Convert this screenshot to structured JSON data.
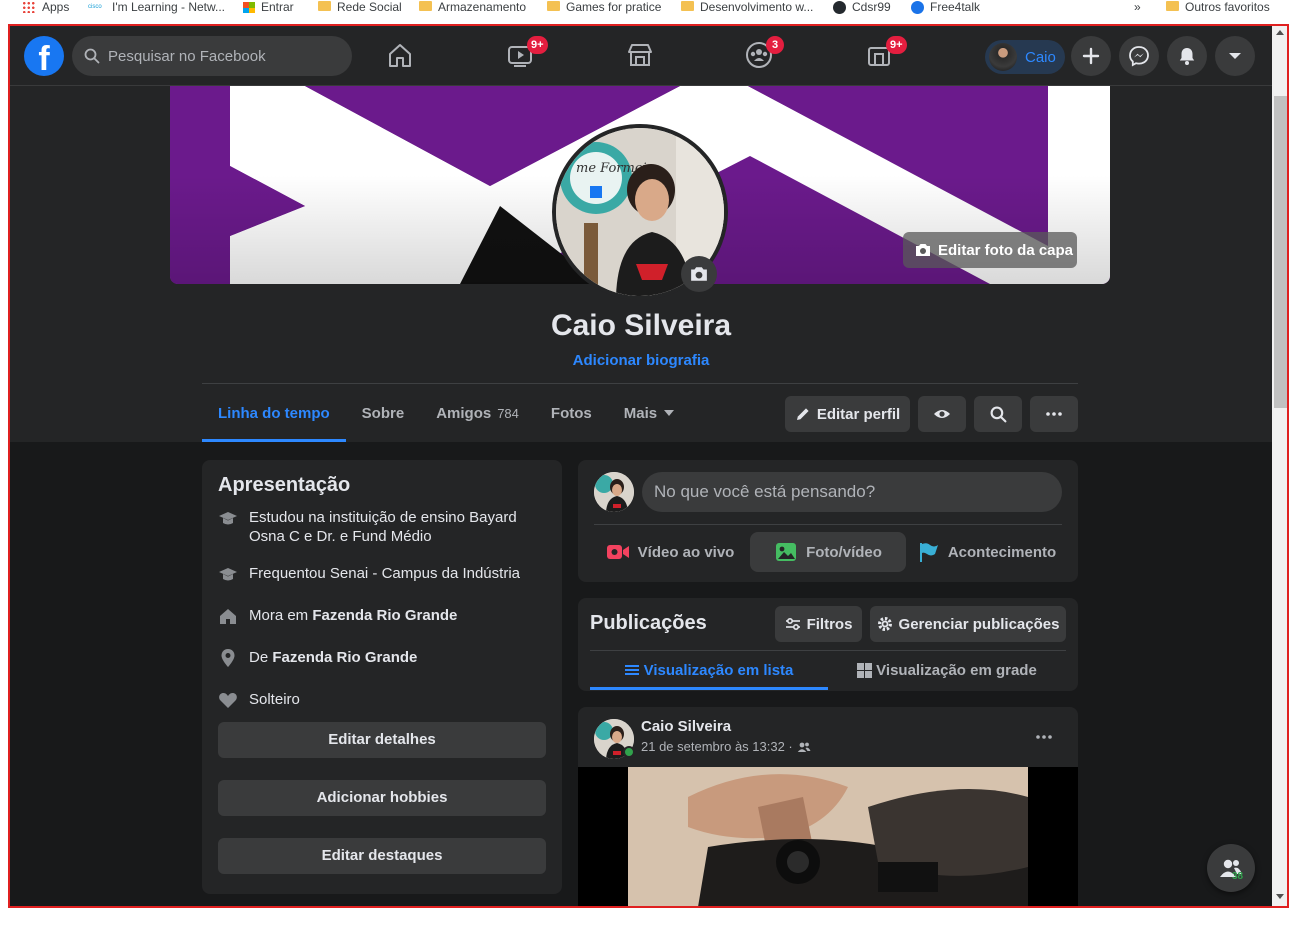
{
  "bookmarks": {
    "items": [
      {
        "label": "Apps"
      },
      {
        "label": "I'm Learning - Netw..."
      },
      {
        "label": "Entrar"
      },
      {
        "label": "Rede Social"
      },
      {
        "label": "Armazenamento"
      },
      {
        "label": "Games for pratice"
      },
      {
        "label": "Desenvolvimento w..."
      },
      {
        "label": "Cdsr99"
      },
      {
        "label": "Free4talk"
      }
    ],
    "overflow": "»",
    "other": "Outros favoritos",
    "cisco_caption": "cisco"
  },
  "nav": {
    "search_placeholder": "Pesquisar no Facebook",
    "badges": {
      "watch": "9+",
      "groups": "3",
      "gaming": "9+"
    },
    "profile_name": "Caio",
    "logo_letter": "f"
  },
  "profile": {
    "name": "Caio Silveira",
    "bio_link": "Adicionar biografia",
    "edit_cover": "Editar foto da capa",
    "picture_caption": "me Formei"
  },
  "tabs": [
    {
      "label": "Linha do tempo",
      "active": true
    },
    {
      "label": "Sobre"
    },
    {
      "label": "Amigos",
      "count": "784"
    },
    {
      "label": "Fotos"
    },
    {
      "label": "Mais"
    }
  ],
  "header_buttons": {
    "edit_profile": "Editar perfil"
  },
  "intro": {
    "title": "Apresentação",
    "items": [
      {
        "text": "Estudou na instituição de ensino Bayard Osna C e Dr. e Fund Médio"
      },
      {
        "text": "Frequentou Senai - Campus da Indústria"
      },
      {
        "prefix": "Mora em ",
        "bold": "Fazenda Rio Grande"
      },
      {
        "prefix": "De ",
        "bold": "Fazenda Rio Grande"
      },
      {
        "text": "Solteiro"
      }
    ],
    "buttons": [
      "Editar detalhes",
      "Adicionar hobbies",
      "Editar destaques"
    ]
  },
  "composer": {
    "placeholder": "No que você está pensando?",
    "actions": [
      "Vídeo ao vivo",
      "Foto/vídeo",
      "Acontecimento"
    ]
  },
  "posts_panel": {
    "title": "Publicações",
    "filters": "Filtros",
    "manage": "Gerenciar publicações",
    "list_view": "Visualização em lista",
    "grid_view": "Visualização em grade"
  },
  "post": {
    "author": "Caio Silveira",
    "time": "21 de setembro às 13:32 ·"
  },
  "contacts": {
    "count": "38"
  },
  "colors": {
    "bg": "#18191a",
    "surface": "#242526",
    "accent": "#2d88ff",
    "badge": "#e41e3f"
  }
}
